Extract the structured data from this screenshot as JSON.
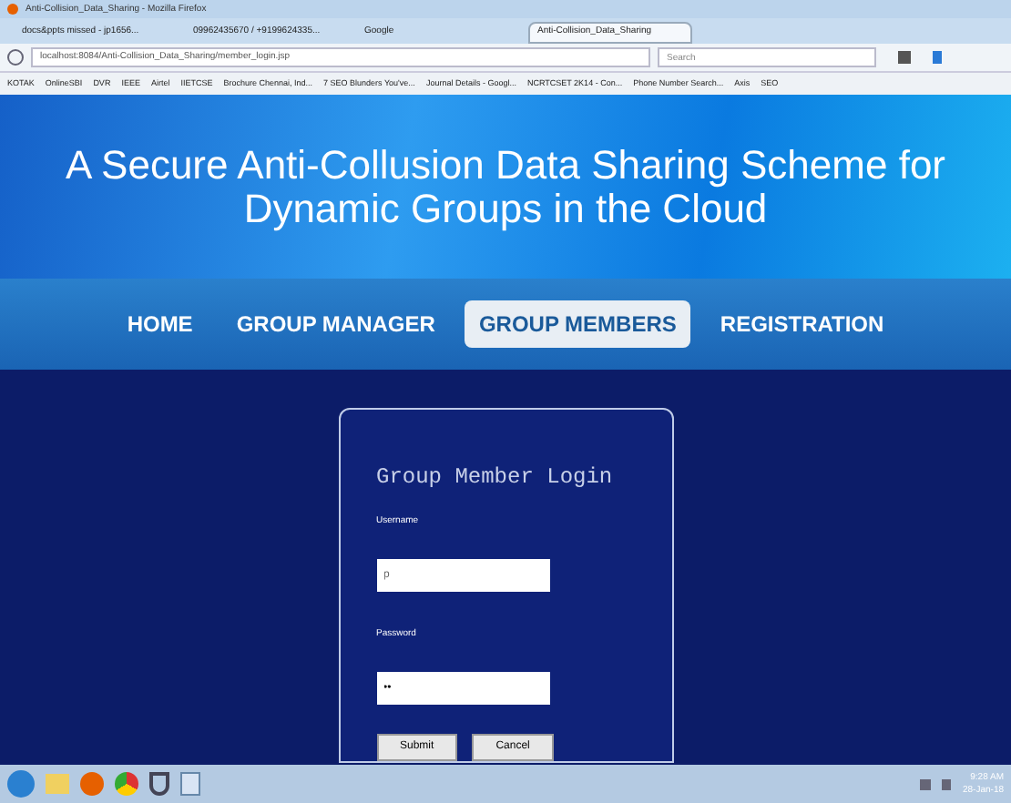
{
  "window": {
    "title": "Anti-Collision_Data_Sharing - Mozilla Firefox"
  },
  "tabs": [
    {
      "label": "docs&ppts missed - jp1656...",
      "selected": false
    },
    {
      "label": "09962435670 / +9199624335...",
      "selected": false
    },
    {
      "label": "Google",
      "selected": false
    },
    {
      "label": "Anti-Collision_Data_Sharing",
      "selected": true
    }
  ],
  "address_bar": {
    "value": "localhost:8084/Anti-Collision_Data_Sharing/member_login.jsp"
  },
  "search": {
    "placeholder": "Search"
  },
  "bookmarks": [
    "KOTAK",
    "OnlineSBI",
    "DVR",
    "IEEE",
    "Airtel",
    "IIETCSE",
    "Brochure Chennai, Ind...",
    "7 SEO Blunders You've...",
    "Journal Details - Googl...",
    "NCRTCSET 2K14 - Con...",
    "Phone Number Search...",
    "Axis",
    "SEO"
  ],
  "header": {
    "title": "A Secure Anti-Collusion Data Sharing Scheme for Dynamic Groups in the Cloud"
  },
  "nav": [
    {
      "label": "HOME",
      "selected": false
    },
    {
      "label": "GROUP MANAGER",
      "selected": false
    },
    {
      "label": "GROUP MEMBERS",
      "selected": true
    },
    {
      "label": "REGISTRATION",
      "selected": false
    }
  ],
  "login": {
    "title": "Group Member Login",
    "username_label": "Username",
    "username_value": "p",
    "password_label": "Password",
    "password_value": "••",
    "buttons": [
      "Submit",
      "Cancel"
    ]
  },
  "taskbar": {
    "time": "9:28 AM",
    "date": "28-Jan-18"
  }
}
